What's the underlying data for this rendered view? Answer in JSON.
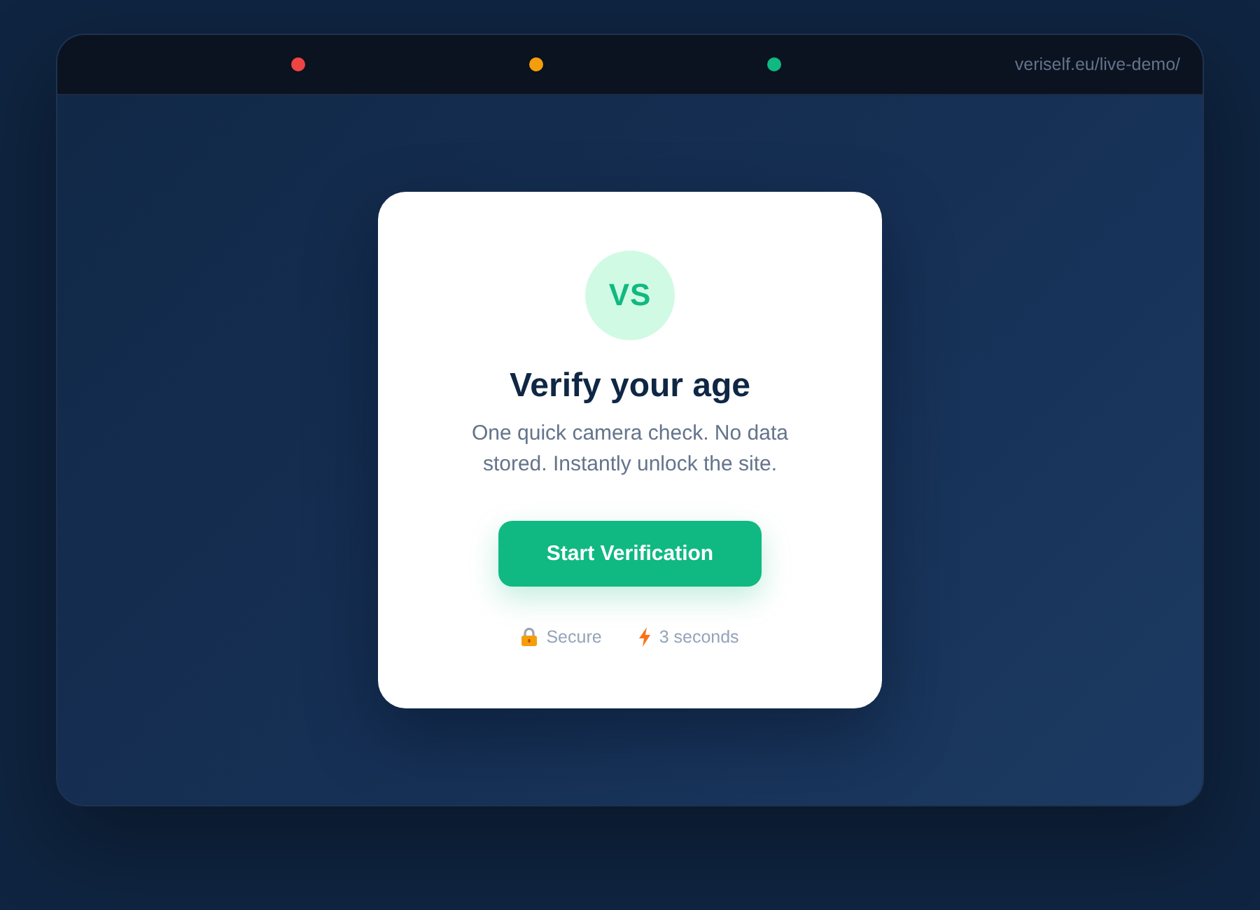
{
  "browser": {
    "window_controls": [
      {
        "color": "#ef4444"
      },
      {
        "color": "#f59e0b"
      },
      {
        "color": "#10b981"
      }
    ],
    "url": "veriself.eu/live-demo/"
  },
  "card": {
    "logo": "VS",
    "title": "Verify your age",
    "description": "One quick camera check. No data stored. Instantly unlock the site.",
    "button": "Start Verification",
    "features": [
      {
        "kind": "lock",
        "label": "Secure"
      },
      {
        "kind": "bolt",
        "label": "3 seconds"
      }
    ]
  }
}
